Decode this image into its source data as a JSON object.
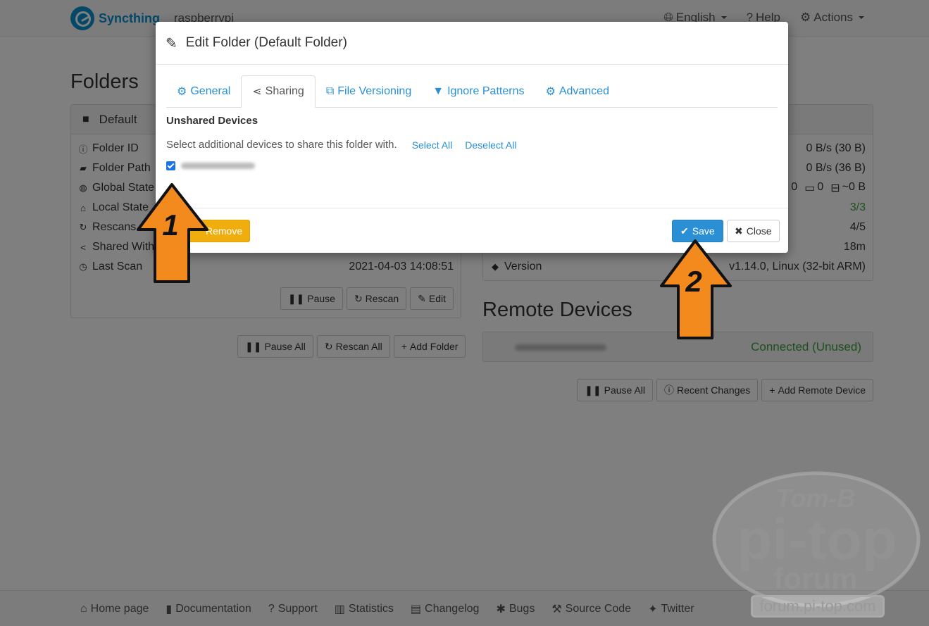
{
  "navbar": {
    "brand": "Syncthing",
    "device_name": "raspberrypi",
    "language": "English",
    "help": "Help",
    "actions": "Actions"
  },
  "folders": {
    "title": "Folders",
    "folder_name": "Default",
    "rows": [
      {
        "label": "Folder ID",
        "icon": "info-icon",
        "value": ""
      },
      {
        "label": "Folder Path",
        "icon": "folder-open-icon",
        "value": ""
      },
      {
        "label": "Global State",
        "icon": "globe-icon",
        "value": ""
      },
      {
        "label": "Local State",
        "icon": "home-icon",
        "value": ""
      },
      {
        "label": "Rescans",
        "icon": "refresh-icon",
        "value": ""
      },
      {
        "label": "Shared With",
        "icon": "share-icon",
        "value": ""
      },
      {
        "label": "Last Scan",
        "icon": "clock-icon",
        "value": "2021-04-03 14:08:51"
      }
    ],
    "buttons": {
      "pause": "Pause",
      "rescan": "Rescan",
      "edit": "Edit"
    },
    "bottom_buttons": {
      "pause_all": "Pause All",
      "rescan_all": "Rescan All",
      "add_folder": "Add Folder"
    }
  },
  "this_device": {
    "rows": [
      {
        "value": "0 B/s (30 B)"
      },
      {
        "value": "0 B/s (36 B)"
      },
      {
        "value_files": "0",
        "value_dirs": "0",
        "value_size": "~0 B"
      },
      {
        "value": "3/3"
      },
      {
        "value": "4/5"
      },
      {
        "value": "18m"
      },
      {
        "label": "Version",
        "value": "v1.14.0, Linux (32-bit ARM)"
      }
    ]
  },
  "remote_devices": {
    "title": "Remote Devices",
    "device_status": "Connected (Unused)",
    "buttons": {
      "pause_all": "Pause All",
      "recent_changes": "Recent Changes",
      "add_remote": "Add Remote Device"
    }
  },
  "footer": {
    "links": [
      "Home page",
      "Documentation",
      "Support",
      "Statistics",
      "Changelog",
      "Bugs",
      "Source Code",
      "Twitter"
    ]
  },
  "modal": {
    "title": "Edit Folder (Default Folder)",
    "tabs": [
      {
        "label": "General",
        "active": false
      },
      {
        "label": "Sharing",
        "active": true
      },
      {
        "label": "File Versioning",
        "active": false
      },
      {
        "label": "Ignore Patterns",
        "active": false
      },
      {
        "label": "Advanced",
        "active": false
      }
    ],
    "section_title": "Unshared Devices",
    "help_text": "Select additional devices to share this folder with.",
    "select_all": "Select All",
    "deselect_all": "Deselect All",
    "device_checked": true,
    "buttons": {
      "remove": "Remove",
      "save": "Save",
      "close": "Close"
    }
  },
  "annotations": {
    "arrow_1": "1",
    "arrow_2": "2"
  },
  "watermark": {
    "line1": "Tom-B",
    "line2": "pi-top",
    "line3": "forum",
    "url": "forum.pi-top.com"
  },
  "colors": {
    "accent": "#2a8fd4",
    "warning": "#f0ad0e",
    "success": "#3c9e3c",
    "arrow": "#f28a1e"
  }
}
